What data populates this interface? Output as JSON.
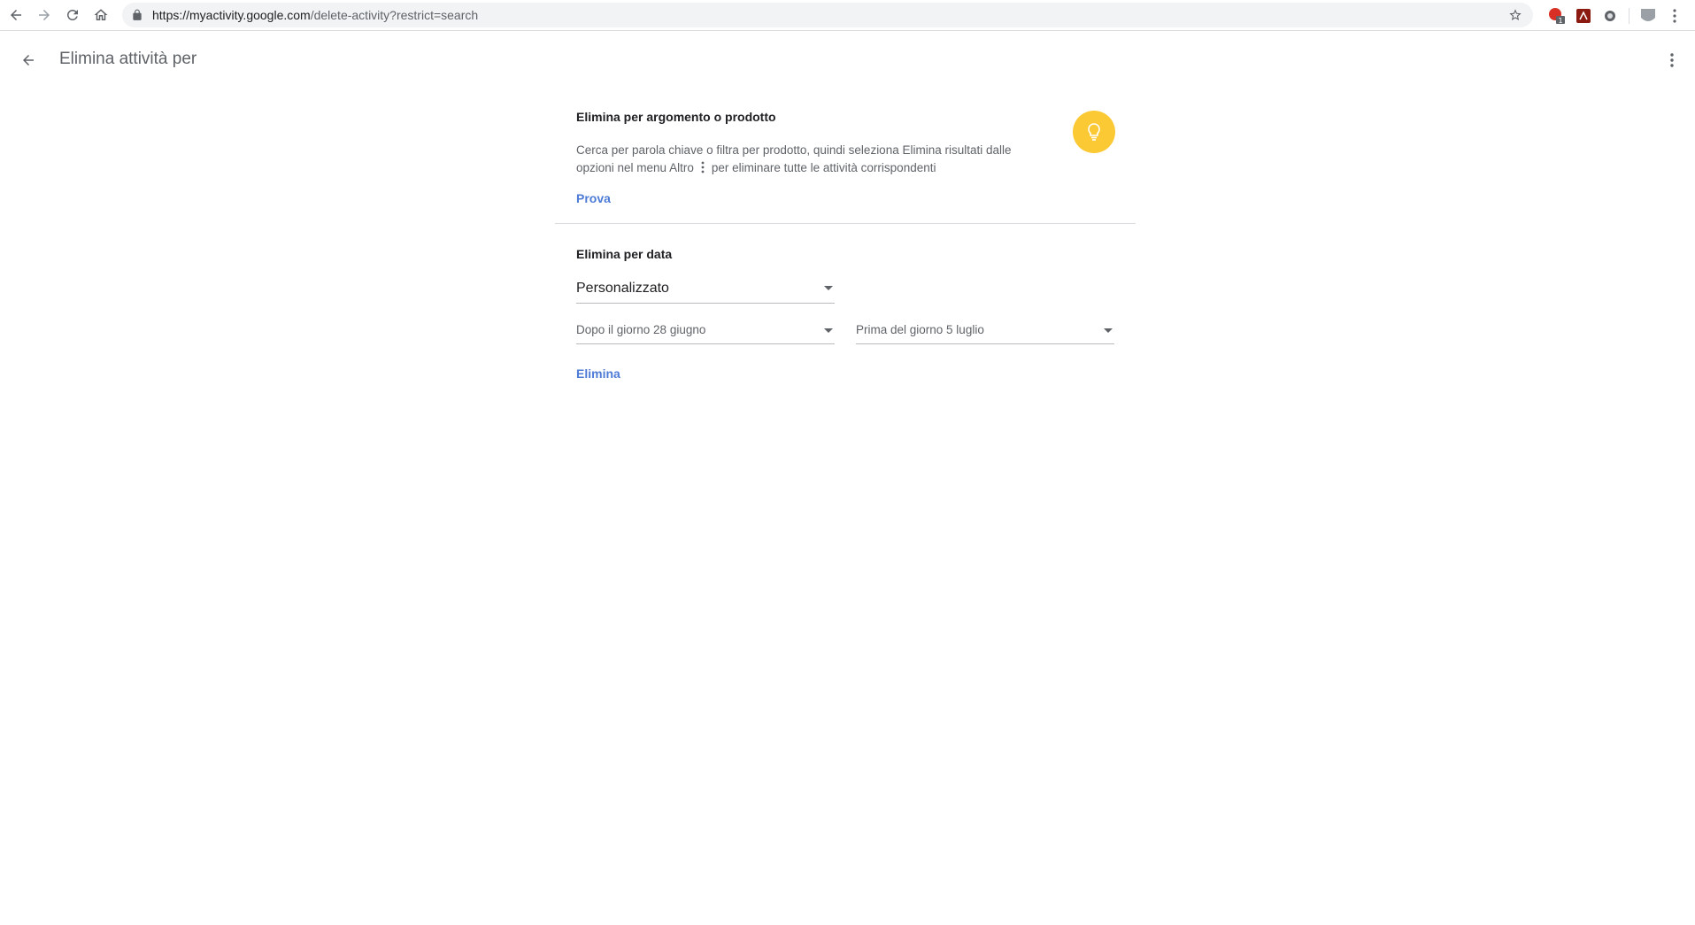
{
  "browser": {
    "url_host": "https://myactivity.google.com",
    "url_path": "/delete-activity?restrict=search",
    "extension_badge": "1"
  },
  "header": {
    "title": "Elimina attività per"
  },
  "topic_section": {
    "title": "Elimina per argomento o prodotto",
    "desc_part1": "Cerca per parola chiave o filtra per prodotto, quindi seleziona Elimina risultati dalle opzioni nel menu Altro",
    "desc_part2": "per eliminare tutte le attività corrispondenti",
    "action_label": "Prova",
    "icon": "lightbulb-icon",
    "icon_color": "#fbc933"
  },
  "date_section": {
    "title": "Elimina per data",
    "range_value": "Personalizzato",
    "after_value": "Dopo il giorno 28 giugno",
    "before_value": "Prima del giorno 5 luglio",
    "action_label": "Elimina"
  },
  "colors": {
    "link": "#4d7bd6",
    "text_secondary": "#5f6368"
  }
}
